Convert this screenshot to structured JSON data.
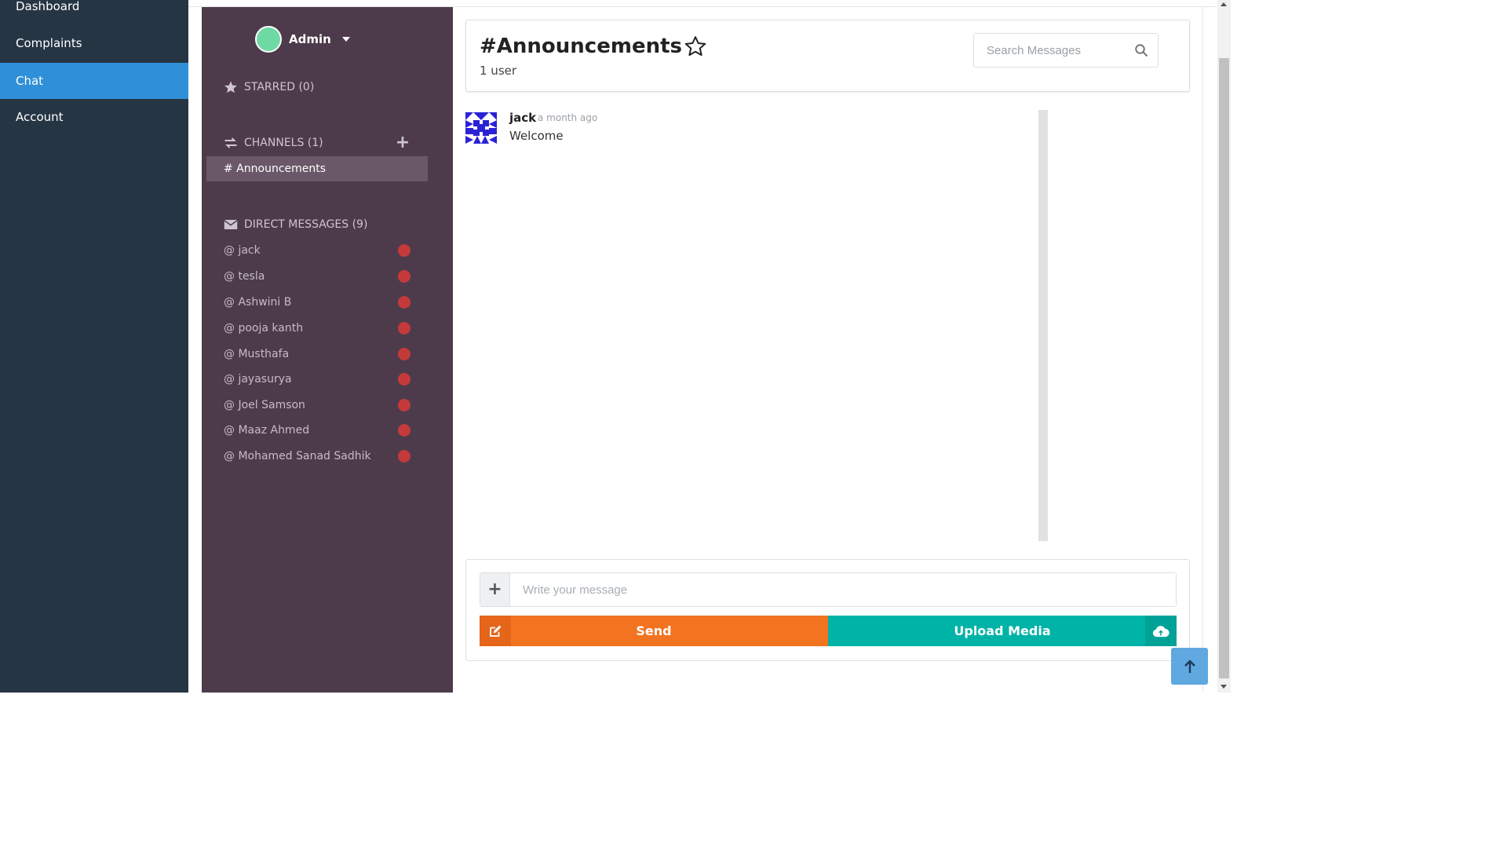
{
  "nav": {
    "items": [
      {
        "label": "Dashboard"
      },
      {
        "label": "Complaints"
      },
      {
        "label": "Chat"
      },
      {
        "label": "Account"
      }
    ],
    "active": "Chat"
  },
  "sidebar": {
    "user": {
      "name": "Admin"
    },
    "starred": {
      "label": "STARRED (0)"
    },
    "channels": {
      "label": "CHANNELS (1)",
      "items": [
        {
          "label": "# Announcements"
        }
      ]
    },
    "direct_messages": {
      "label": "DIRECT MESSAGES (9)",
      "items": [
        {
          "label": "@ jack"
        },
        {
          "label": "@ tesla"
        },
        {
          "label": "@ Ashwini B"
        },
        {
          "label": "@ pooja kanth"
        },
        {
          "label": "@ Musthafa"
        },
        {
          "label": "@ jayasurya"
        },
        {
          "label": "@ Joel Samson"
        },
        {
          "label": "@ Maaz Ahmed"
        },
        {
          "label": "@ Mohamed Sanad Sadhik"
        }
      ]
    }
  },
  "channel": {
    "title": "#Announcements",
    "user_count": "1 user"
  },
  "search": {
    "placeholder": "Search Messages"
  },
  "messages": [
    {
      "author": "jack",
      "time": "a month ago",
      "text": "Welcome"
    }
  ],
  "composer": {
    "placeholder": "Write your message",
    "send_label": "Send",
    "upload_label": "Upload Media"
  },
  "colors": {
    "nav_bg": "#263544",
    "nav_active": "#2f8fd8",
    "sidebar_bg": "#4d3b4b",
    "send": "#f27420",
    "upload": "#00b3a7",
    "status_offline": "#c43a3a"
  },
  "icons": {
    "star": "star-icon",
    "channels": "exchange-icon",
    "dm": "envelope-icon",
    "search": "search-icon",
    "send": "edit-icon",
    "upload": "cloud-upload-icon",
    "back_to_top": "arrow-up-icon"
  }
}
